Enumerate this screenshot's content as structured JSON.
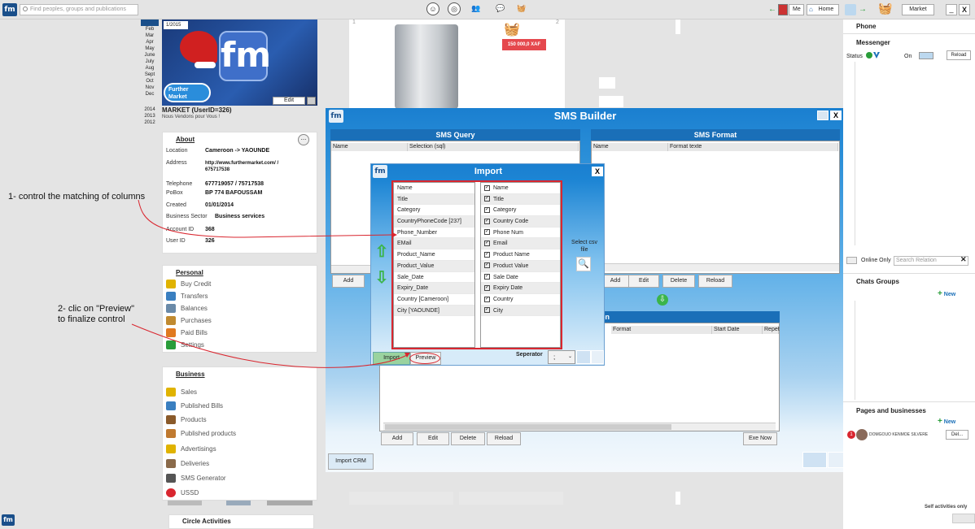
{
  "topbar": {
    "search_placeholder": "Find peoples, groups and publications",
    "me_label": "Me",
    "home_label": "Home",
    "market_label": "Market"
  },
  "calendar": {
    "months": [
      "Jan",
      "Feb",
      "Mar",
      "Apr",
      "May",
      "June",
      "July",
      "Aug",
      "Sept",
      "Oct",
      "Nov",
      "Dec"
    ],
    "years": [
      "2014",
      "2013",
      "2012"
    ]
  },
  "profile": {
    "date_badge": "1/2015",
    "cover_logo": "fm",
    "edit_label": "Edit",
    "name": "MARKET (UserID=326)",
    "slogan": "Nous Vendons pour Vous !"
  },
  "about": {
    "title": "About",
    "more": "...",
    "rows": [
      {
        "k": "Location",
        "v": "Cameroon -> YAOUNDE"
      },
      {
        "k": "Address",
        "v": "http://www.furthermarket.com/ / 675717538"
      },
      {
        "k": "Telephone",
        "v": "677719057 / 75717538"
      },
      {
        "k": "PoBox",
        "v": "BP 774 BAFOUSSAM"
      },
      {
        "k": "Created",
        "v": "01/01/2014"
      },
      {
        "k": "Business Sector",
        "v": "Business services"
      },
      {
        "k": "Account ID",
        "v": "368"
      },
      {
        "k": "User ID",
        "v": "326"
      }
    ]
  },
  "personal": {
    "title": "Personal",
    "items": [
      "Buy Credit",
      "Transfers",
      "Balances",
      "Purchases",
      "Paid Bills",
      "Settings"
    ]
  },
  "business": {
    "title": "Business",
    "items": [
      "Sales",
      "Published Bills",
      "Products",
      "Published products",
      "Advertisings",
      "Deliveries",
      "SMS Generator",
      "USSD"
    ]
  },
  "circle": {
    "title": "Circle Activities"
  },
  "product": {
    "price": "150 000,0 XAF",
    "num1": "1",
    "num2": "2"
  },
  "sms_builder": {
    "title": "SMS Builder",
    "query": {
      "title": "SMS Query",
      "col1": "Name",
      "col2": "Selection (sql)",
      "add": "Add"
    },
    "format": {
      "title": "SMS Format",
      "col1": "Name",
      "col2": "Format texte",
      "add": "Add",
      "edit": "Edit",
      "delete": "Delete",
      "reload": "Reload"
    },
    "lower": {
      "title": "on",
      "col_format": "Format",
      "col_start": "Start Date",
      "col_rep": "Repet",
      "add": "Add",
      "edit": "Edit",
      "delete": "Delete",
      "reload": "Reload",
      "exe": "Exe Now"
    },
    "import_crm": "Import CRM"
  },
  "import": {
    "title": "Import",
    "csv_columns": [
      "Name",
      "Title",
      "Category",
      "CountryPhoneCode [237]",
      "Phone_Number",
      "EMail",
      "Product_Name",
      "Product_Value",
      "Sale_Date",
      "Expiry_Date",
      "Country [Cameroon]",
      "City [YAOUNDE]"
    ],
    "target_columns": [
      "Name",
      "Title",
      "Category",
      "Country Code",
      "Phone Num",
      "Email",
      "Product Name",
      "Product Value",
      "Sale Date",
      "Expiry Date",
      "Country",
      "City"
    ],
    "select_csv": "Select csv file",
    "import_btn": "Import",
    "preview_btn": "Preview",
    "separator_label": "Seperator",
    "separator_value": ";"
  },
  "annotations": {
    "a1": "1- control the matching of columns",
    "a2_line1": "2- clic on \"Preview\"",
    "a2_line2": "to finalize control"
  },
  "right": {
    "phone": "Phone",
    "messenger": "Messenger",
    "status": "Status",
    "on": "On",
    "reload": "Reload",
    "online_only": "Online Only",
    "search_relation": "Search Relation",
    "chats_groups": "Chats Groups",
    "new1": "New",
    "pages": "Pages and businesses",
    "new2": "New",
    "badge": "1",
    "person": "DOMGOUO KENMOE SILVERE",
    "del": "Del...",
    "self_only": "Self activities only"
  },
  "colors": {
    "accent": "#1a7fd0",
    "dark_title": "#1a6fb8",
    "annotation": "#d9262f",
    "price": "#e5484d"
  }
}
